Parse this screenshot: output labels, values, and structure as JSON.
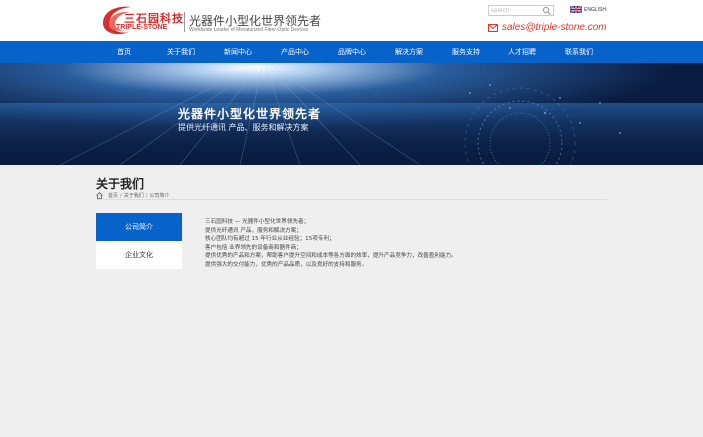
{
  "header": {
    "brand_cn": "三石园科技",
    "brand_en": "TRIPLE-STONE",
    "slogan_cn": "光器件小型化世界领先者",
    "slogan_en": "Worldwide Leader of Miniaturized Fiber-Optic Devices",
    "search_placeholder": "search",
    "language_label": "ENGLISH",
    "email": "sales@triple-stone.com"
  },
  "nav": {
    "items": [
      {
        "label": "首页"
      },
      {
        "label": "关于我们"
      },
      {
        "label": "新闻中心"
      },
      {
        "label": "产品中心"
      },
      {
        "label": "品牌中心"
      },
      {
        "label": "解决方案"
      },
      {
        "label": "服务支持"
      },
      {
        "label": "人才招聘"
      },
      {
        "label": "联系我们"
      }
    ]
  },
  "banner": {
    "title": "光器件小型化世界领先者",
    "subtitle": "提供光纤通讯 产品、服务和解决方案"
  },
  "page": {
    "title": "关于我们",
    "breadcrumb": [
      "首页",
      "关于我们",
      "公司简介"
    ],
    "breadcrumb_sep": "/"
  },
  "sidebar": {
    "items": [
      {
        "label": "公司简介",
        "active": true
      },
      {
        "label": "企业文化",
        "active": false
      }
    ]
  },
  "content": {
    "lines": [
      "三石园科技 — 光器件小型化世界领先者；",
      "提供光纤通讯 产品，服务和解决方案；",
      "核心团队均有超过 15 年行业从业经验；15项专利；",
      "客户包括 业界领先的设备商和器件商；",
      "提供优秀的产品和方案，帮助客户提升空间和成本等各方面的效率，提升产品竞争力，改善盈利能力。",
      "提供强大的交付能力，优秀的产品品质，以及良好的支持和服务。"
    ]
  },
  "colors": {
    "accent": "#0762c9",
    "brand_red": "#d62d2d",
    "email_red": "#e0382a"
  }
}
